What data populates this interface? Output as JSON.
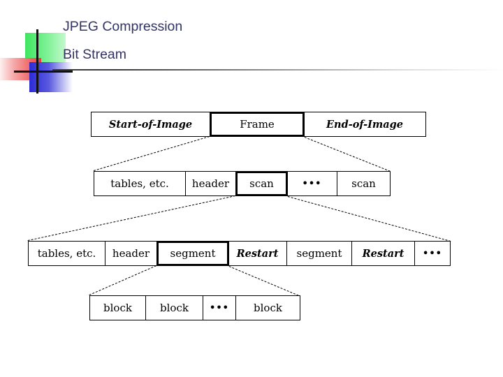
{
  "slide": {
    "title_lines": [
      "JPEG Compression",
      "Bit Stream"
    ],
    "title_color": "#333366"
  },
  "logo": {
    "green_color": "#3ae35c",
    "red_color": "#e93c3c",
    "blue_color": "#2b2bd6",
    "cross_color": "#111111"
  },
  "diagram": {
    "rows": [
      {
        "name": "image-level",
        "cells": [
          {
            "label": "Start-of-Image",
            "style": "italic",
            "highlight": false
          },
          {
            "label": "Frame",
            "style": "roman",
            "highlight": true
          },
          {
            "label": "End-of-Image",
            "style": "italic",
            "highlight": false
          }
        ]
      },
      {
        "name": "frame-level",
        "cells": [
          {
            "label": "tables, etc.",
            "style": "roman",
            "highlight": false
          },
          {
            "label": "header",
            "style": "roman",
            "highlight": false
          },
          {
            "label": "scan",
            "style": "roman",
            "highlight": true
          },
          {
            "label": "•••",
            "style": "ellipsis",
            "highlight": false
          },
          {
            "label": "scan",
            "style": "roman",
            "highlight": false
          }
        ]
      },
      {
        "name": "scan-level",
        "cells": [
          {
            "label": "tables, etc.",
            "style": "roman",
            "highlight": false
          },
          {
            "label": "header",
            "style": "roman",
            "highlight": false
          },
          {
            "label": "segment",
            "style": "roman",
            "highlight": true
          },
          {
            "label": "Restart",
            "style": "italic",
            "highlight": false
          },
          {
            "label": "segment",
            "style": "roman",
            "highlight": false
          },
          {
            "label": "Restart",
            "style": "italic",
            "highlight": false
          },
          {
            "label": "•••",
            "style": "ellipsis",
            "highlight": false
          }
        ]
      },
      {
        "name": "segment-level",
        "cells": [
          {
            "label": "block",
            "style": "roman",
            "highlight": false
          },
          {
            "label": "block",
            "style": "roman",
            "highlight": false
          },
          {
            "label": "•••",
            "style": "ellipsis",
            "highlight": false
          },
          {
            "label": "block",
            "style": "roman",
            "highlight": false
          }
        ]
      }
    ]
  }
}
